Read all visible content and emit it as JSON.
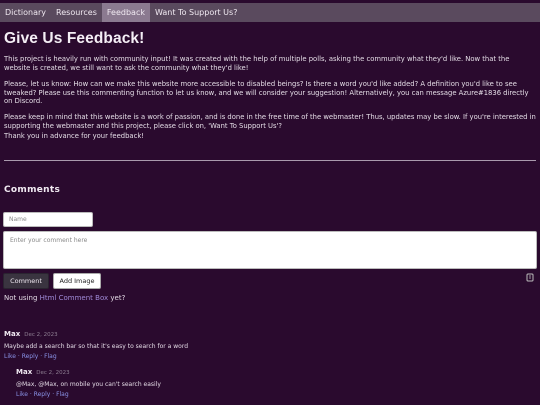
{
  "nav": {
    "items": [
      {
        "label": "Dictionary",
        "active": false
      },
      {
        "label": "Resources",
        "active": false
      },
      {
        "label": "Feedback",
        "active": true
      },
      {
        "label": "Want To Support Us?",
        "active": false
      }
    ]
  },
  "page": {
    "title": "Give Us Feedback!",
    "paragraphs": [
      "This project is heavily run with community input! It was created with the help of multiple polls, asking the community what they'd like. Now that the website is created, we still want to ask the community what they'd like!",
      "Please, let us know: How can we make this website more accessible to disabled beings? Is there a word you'd like added? A definition you'd like to see tweaked? Please use this commenting function to let us know, and we will consider your suggestion! Alternatively, you can message Azure#1836 directly on Discord.",
      "Please keep in mind that this website is a work of passion, and is done in the free time of the webmaster! Thus, updates may be slow. If you're interested in supporting the webmaster and this project, please click on, 'Want To Support Us'?",
      "Thank you in advance for your feedback!"
    ]
  },
  "comments_section": {
    "heading": "Comments",
    "name_placeholder": "Name",
    "comment_placeholder": "Enter your comment here",
    "comment_button": "Comment",
    "add_image_button": "Add Image",
    "not_using_prefix": "Not using ",
    "not_using_link": "Html Comment Box",
    "not_using_suffix": "  yet?",
    "comments": [
      {
        "author": "Max",
        "date": "Dec 2, 2023",
        "text": "Maybe add a search bar so that it's easy to search for a word",
        "actions": [
          "Like",
          "Reply",
          "Flag"
        ]
      },
      {
        "author": "Max",
        "date": "Dec 2, 2023",
        "text": "@Max, @Max, on mobile you can't search easily",
        "actions": [
          "Like",
          "Reply",
          "Flag"
        ]
      }
    ],
    "action_separator": " · "
  },
  "colors": {
    "background": "#2a0a2e",
    "navbar": "#5a4a5e",
    "nav_active": "#8b7a90",
    "link": "#8a93e8"
  }
}
